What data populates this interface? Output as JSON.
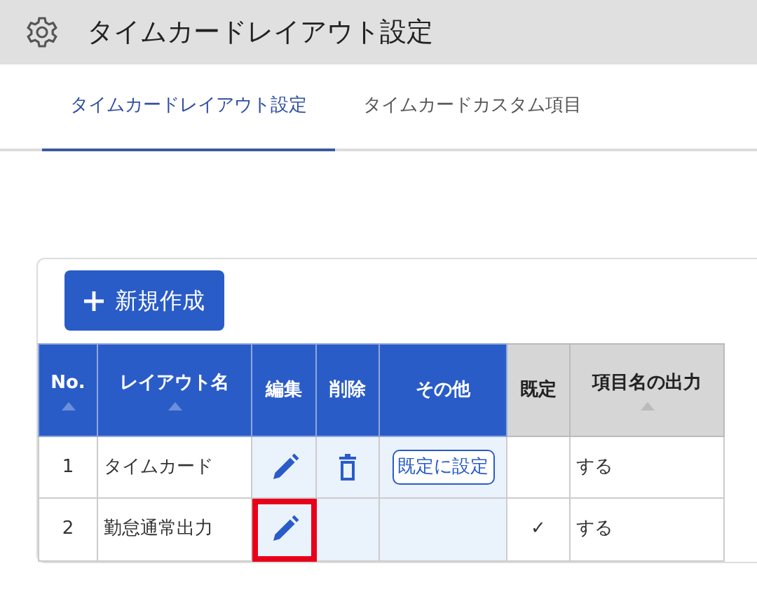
{
  "header": {
    "title": "タイムカードレイアウト設定"
  },
  "tabs": [
    {
      "label": "タイムカードレイアウト設定",
      "selected": true
    },
    {
      "label": "タイムカードカスタム項目",
      "selected": false
    }
  ],
  "new_button": {
    "label": "新規作成"
  },
  "table": {
    "columns": [
      {
        "label": "No.",
        "sortable": true,
        "kind": "primary"
      },
      {
        "label": "レイアウト名",
        "sortable": true,
        "kind": "primary"
      },
      {
        "label": "編集",
        "sortable": false,
        "kind": "primary"
      },
      {
        "label": "削除",
        "sortable": false,
        "kind": "primary"
      },
      {
        "label": "その他",
        "sortable": false,
        "kind": "primary"
      },
      {
        "label": "既定",
        "sortable": false,
        "kind": "plain"
      },
      {
        "label": "項目名の出力",
        "sortable": true,
        "kind": "plain"
      }
    ],
    "rows": [
      {
        "no": "1",
        "name": "タイムカード",
        "editable": true,
        "deletable": true,
        "other_button": "既定に設定",
        "output": "する",
        "highlighted": false
      },
      {
        "no": "2",
        "name": "勤怠通常出力",
        "editable": true,
        "deletable": false,
        "default_mark": "✓",
        "output": "する",
        "highlighted": true
      }
    ]
  }
}
